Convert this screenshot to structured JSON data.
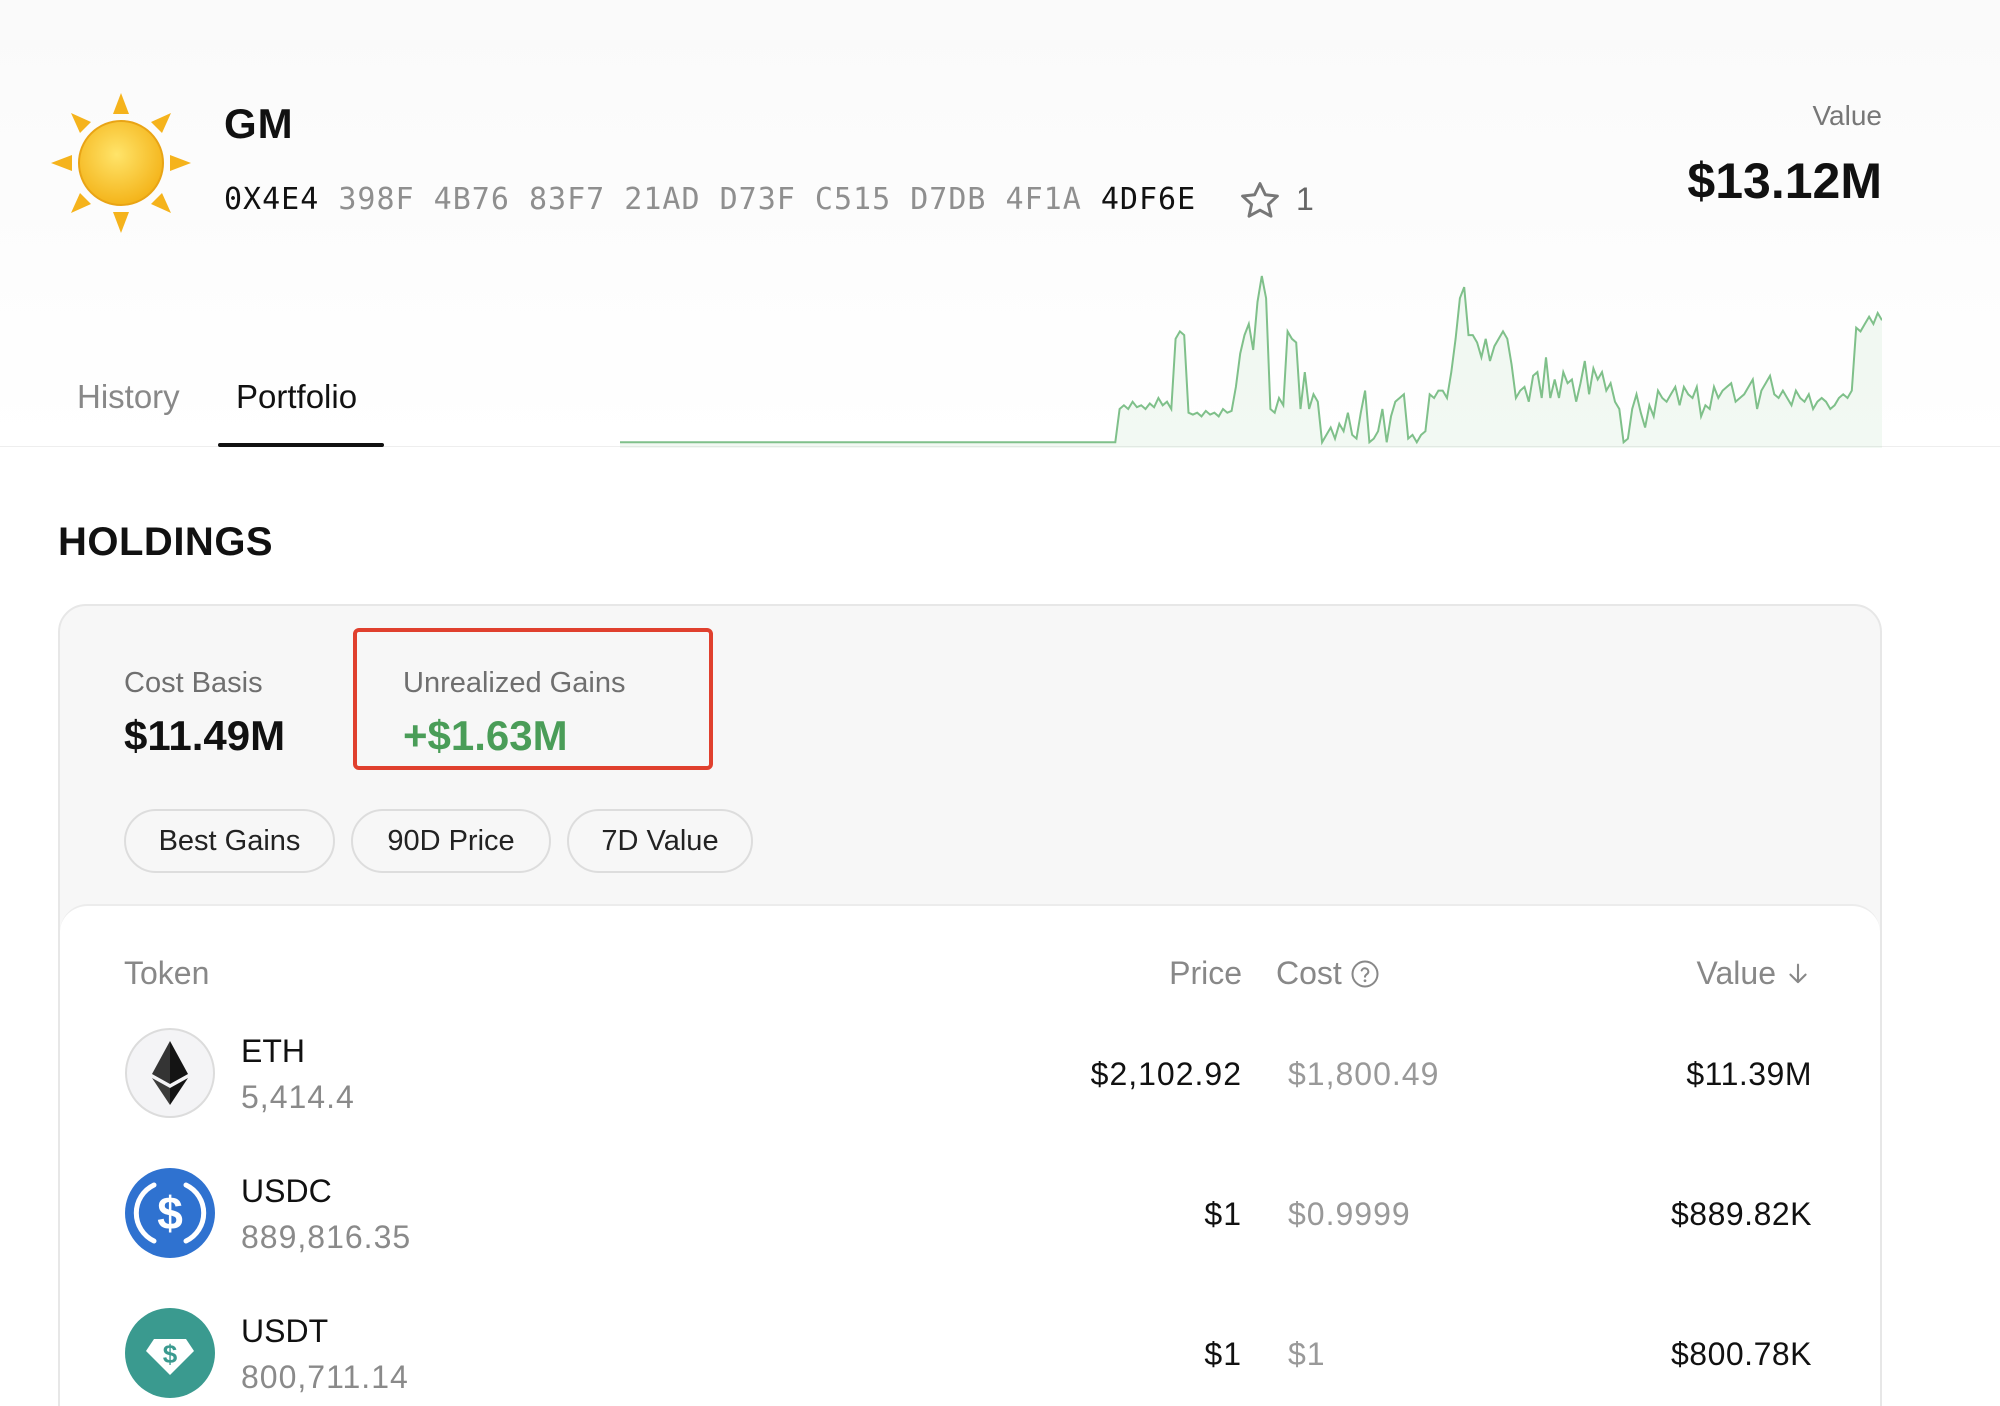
{
  "wallet": {
    "name": "GM",
    "address_prefix": "0X4E4",
    "address_middle": " 398F 4B76 83F7 21AD D73F C515 D7DB 4F1A ",
    "address_suffix": "4DF6E",
    "star_count": "1",
    "avatar_icon": "sun-icon"
  },
  "summary": {
    "value_label": "Value",
    "value_amount": "$13.12M"
  },
  "tabs": [
    {
      "label": "History",
      "active": false
    },
    {
      "label": "Portfolio",
      "active": true
    }
  ],
  "sparkline": {
    "color": "#7fc08a",
    "values": [
      2,
      2,
      2,
      2,
      2,
      2,
      2,
      2,
      2,
      2,
      2,
      2,
      2,
      2,
      2,
      2,
      2,
      2,
      2,
      2,
      2,
      2,
      2,
      2,
      2,
      2,
      2,
      2,
      2,
      2,
      2,
      2,
      2,
      2,
      2,
      2,
      2,
      2,
      2,
      2,
      2,
      2,
      2,
      2,
      2,
      2,
      2,
      2,
      2,
      2,
      2,
      2,
      2,
      2,
      2,
      2,
      2,
      2,
      2,
      2,
      2,
      2,
      2,
      2,
      2,
      2,
      2,
      2,
      2,
      2,
      2,
      2,
      2,
      2,
      2,
      2,
      2,
      2,
      2,
      2,
      2,
      2,
      2,
      2,
      2,
      2,
      2,
      2,
      2,
      2,
      2,
      2,
      2,
      2,
      2,
      2,
      2,
      2,
      2,
      2,
      2,
      2,
      2,
      2,
      2,
      2,
      2,
      2,
      2,
      2,
      2,
      2,
      2,
      2,
      2,
      2,
      20,
      22,
      20,
      24,
      21,
      22,
      20,
      23,
      21,
      26,
      22,
      24,
      20,
      58,
      62,
      60,
      18,
      17,
      18,
      16,
      19,
      17,
      18,
      16,
      20,
      18,
      19,
      32,
      50,
      60,
      66,
      52,
      78,
      92,
      80,
      20,
      18,
      26,
      22,
      62,
      58,
      56,
      20,
      40,
      20,
      28,
      24,
      2,
      6,
      10,
      4,
      12,
      8,
      18,
      6,
      4,
      18,
      30,
      2,
      4,
      8,
      20,
      2,
      16,
      24,
      26,
      28,
      4,
      6,
      2,
      6,
      8,
      28,
      26,
      30,
      30,
      26,
      40,
      58,
      80,
      86,
      60,
      60,
      56,
      48,
      58,
      46,
      54,
      58,
      62,
      58,
      44,
      26,
      30,
      32,
      24,
      38,
      40,
      26,
      48,
      26,
      36,
      26,
      40,
      34,
      36,
      24,
      34,
      46,
      28,
      42,
      36,
      40,
      30,
      34,
      24,
      20,
      2,
      4,
      20,
      28,
      18,
      10,
      22,
      16,
      30,
      26,
      24,
      28,
      32,
      22,
      32,
      28,
      26,
      32,
      16,
      22,
      20,
      32,
      26,
      30,
      32,
      34,
      24,
      26,
      28,
      32,
      36,
      20,
      30,
      34,
      38,
      28,
      26,
      30,
      26,
      22,
      30,
      26,
      24,
      28,
      20,
      24,
      26,
      24,
      20,
      22,
      26,
      28,
      26,
      30,
      64,
      62,
      66,
      70,
      66,
      72,
      68
    ]
  },
  "holdings": {
    "title": "HOLDINGS",
    "cost_basis_label": "Cost Basis",
    "cost_basis_value": "$11.49M",
    "unrealized_label": "Unrealized Gains",
    "unrealized_value": "+$1.63M",
    "gain_color": "#4a9d58",
    "highlight_color": "#e0402e",
    "filters": [
      "Best Gains",
      "90D Price",
      "7D Value"
    ]
  },
  "table": {
    "headers": {
      "token": "Token",
      "price": "Price",
      "cost": "Cost",
      "value": "Value"
    },
    "rows": [
      {
        "symbol": "ETH",
        "amount": "5,414.4",
        "price": "$2,102.92",
        "cost": "$1,800.49",
        "value": "$11.39M",
        "icon": "ethereum-icon"
      },
      {
        "symbol": "USDC",
        "amount": "889,816.35",
        "price": "$1",
        "cost": "$0.9999",
        "value": "$889.82K",
        "icon": "usdc-icon"
      },
      {
        "symbol": "USDT",
        "amount": "800,711.14",
        "price": "$1",
        "cost": "$1",
        "value": "$800.78K",
        "icon": "usdt-icon"
      }
    ]
  }
}
